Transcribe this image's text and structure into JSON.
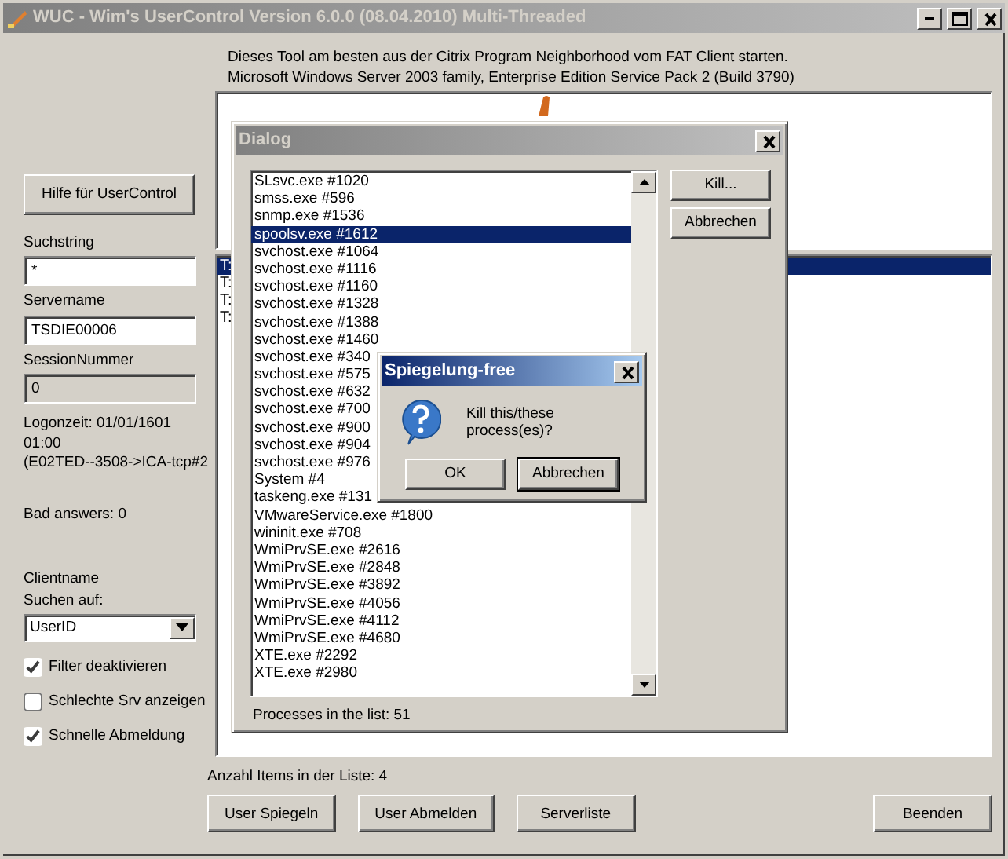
{
  "window": {
    "title": "WUC - Wim's UserControl Version 6.0.0 (08.04.2010) Multi-Threaded",
    "active": false
  },
  "header_lines": [
    "Dieses Tool am besten aus der Citrix Program Neighborhood vom FAT Client  starten.",
    "Microsoft Windows Server 2003 family, Enterprise Edition Service Pack 2 (Build 3790)"
  ],
  "sidebar": {
    "help_button": "Hilfe für UserControl",
    "fields": [
      {
        "label": "Suchstring",
        "value": "*",
        "disabled": false
      },
      {
        "label": "Servername",
        "value": "TSDIE00006",
        "disabled": false
      },
      {
        "label": "SessionNummer",
        "value": "0",
        "disabled": true
      }
    ],
    "logon_lines": [
      "Logonzeit: 01/01/1601",
      "01:00",
      "(E02TED--3508->ICA-tcp#2"
    ],
    "bad_answers": "Bad answers: 0",
    "clientname": "Clientname",
    "search_label": "Suchen auf:",
    "search_value": "UserID",
    "checkboxes": [
      {
        "label": "Filter deaktivieren",
        "checked": true
      },
      {
        "label": "Schlechte Srv anzeigen",
        "checked": false
      },
      {
        "label": "Schnelle Abmeldung",
        "checked": true
      }
    ]
  },
  "main_list": {
    "rows": [
      {
        "text": "T:",
        "selected": true
      },
      {
        "text": "T:",
        "selected": false
      },
      {
        "text": "T:",
        "selected": false
      },
      {
        "text": "T:",
        "selected": false
      }
    ]
  },
  "item_count": "Anzahl Items in der Liste: 4",
  "buttons": [
    {
      "label": "User Spiegeln",
      "kind": "left"
    },
    {
      "label": "User Abmelden",
      "kind": "left"
    },
    {
      "label": "Serverliste",
      "kind": "left"
    },
    {
      "label": "Beenden",
      "kind": "right"
    }
  ],
  "dialog": {
    "title": "Dialog",
    "active": false,
    "processes": [
      {
        "name": "SLsvc.exe #1020",
        "selected": false
      },
      {
        "name": "smss.exe #596",
        "selected": false
      },
      {
        "name": "snmp.exe #1536",
        "selected": false
      },
      {
        "name": "spoolsv.exe #1612",
        "selected": true
      },
      {
        "name": "svchost.exe #1064",
        "selected": false
      },
      {
        "name": "svchost.exe #1116",
        "selected": false
      },
      {
        "name": "svchost.exe #1160",
        "selected": false
      },
      {
        "name": "svchost.exe #1328",
        "selected": false
      },
      {
        "name": "svchost.exe #1388",
        "selected": false
      },
      {
        "name": "svchost.exe #1460",
        "selected": false
      },
      {
        "name": "svchost.exe #340",
        "selected": false
      },
      {
        "name": "svchost.exe #575",
        "selected": false
      },
      {
        "name": "svchost.exe #632",
        "selected": false
      },
      {
        "name": "svchost.exe #700",
        "selected": false
      },
      {
        "name": "svchost.exe #900",
        "selected": false
      },
      {
        "name": "svchost.exe #904",
        "selected": false
      },
      {
        "name": "svchost.exe #976",
        "selected": false
      },
      {
        "name": "System #4",
        "selected": false
      },
      {
        "name": "taskeng.exe #131",
        "selected": false
      },
      {
        "name": "VMwareService.exe #1800",
        "selected": false
      },
      {
        "name": "wininit.exe #708",
        "selected": false
      },
      {
        "name": "WmiPrvSE.exe #2616",
        "selected": false
      },
      {
        "name": "WmiPrvSE.exe #2848",
        "selected": false
      },
      {
        "name": "WmiPrvSE.exe #3892",
        "selected": false
      },
      {
        "name": "WmiPrvSE.exe #4056",
        "selected": false
      },
      {
        "name": "WmiPrvSE.exe #4112",
        "selected": false
      },
      {
        "name": "WmiPrvSE.exe #4680",
        "selected": false
      },
      {
        "name": "XTE.exe #2292",
        "selected": false
      },
      {
        "name": "XTE.exe #2980",
        "selected": false
      }
    ],
    "buttons": [
      "Kill...",
      "Abbrechen"
    ],
    "count": "Processes in the list: 51"
  },
  "message_box": {
    "title": "Spiegelung-free",
    "active": true,
    "text": "Kill this/these process(es)?",
    "buttons": [
      {
        "label": "OK",
        "focused": false
      },
      {
        "label": "Abbrechen",
        "focused": true
      }
    ]
  }
}
